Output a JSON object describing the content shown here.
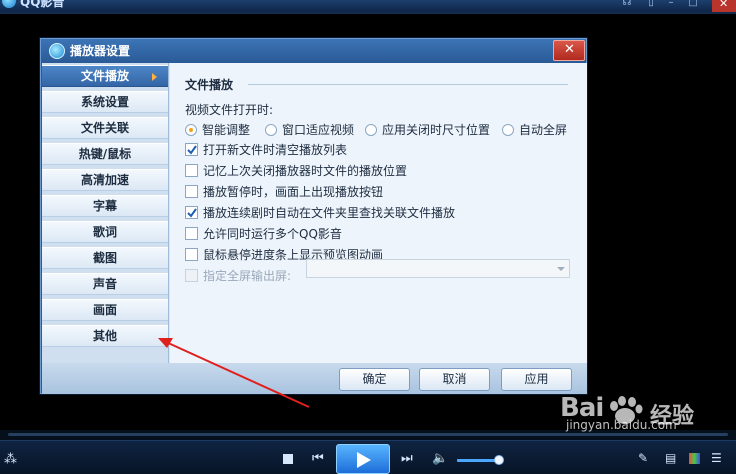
{
  "app": {
    "title": "QQ影音"
  },
  "dialog": {
    "title": "播放器设置",
    "close_symbol": "✕",
    "nav": [
      {
        "label": "文件播放",
        "active": true
      },
      {
        "label": "系统设置",
        "active": false
      },
      {
        "label": "文件关联",
        "active": false
      },
      {
        "label": "热键/鼠标",
        "active": false
      },
      {
        "label": "高清加速",
        "active": false
      },
      {
        "label": "字幕",
        "active": false
      },
      {
        "label": "歌词",
        "active": false
      },
      {
        "label": "截图",
        "active": false
      },
      {
        "label": "声音",
        "active": false
      },
      {
        "label": "画面",
        "active": false
      },
      {
        "label": "其他",
        "active": false
      }
    ],
    "section_title": "文件播放",
    "open_label": "视频文件打开时:",
    "radios": [
      {
        "label": "智能调整",
        "selected": true
      },
      {
        "label": "窗口适应视频",
        "selected": false
      },
      {
        "label": "应用关闭时尺寸位置",
        "selected": false
      },
      {
        "label": "自动全屏",
        "selected": false
      }
    ],
    "checkboxes": [
      {
        "label": "打开新文件时清空播放列表",
        "checked": true,
        "enabled": true
      },
      {
        "label": "记忆上次关闭播放器时文件的播放位置",
        "checked": false,
        "enabled": true
      },
      {
        "label": "播放暂停时，画面上出现播放按钮",
        "checked": false,
        "enabled": true
      },
      {
        "label": "播放连续剧时自动在文件夹里查找关联文件播放",
        "checked": true,
        "enabled": true
      },
      {
        "label": "允许同时运行多个QQ影音",
        "checked": false,
        "enabled": true
      },
      {
        "label": "鼠标悬停进度条上显示预览图动画",
        "checked": false,
        "enabled": true
      },
      {
        "label": "指定全屏输出屏:",
        "checked": false,
        "enabled": false
      }
    ],
    "screen_select": {
      "value": ""
    },
    "buttons": {
      "ok": "确定",
      "cancel": "取消",
      "apply": "应用"
    }
  },
  "player": {
    "volume_fraction": 0.9
  },
  "watermark": {
    "brand": "Bai",
    "brand_cn": "经验",
    "url": "jingyan.baidu.com"
  },
  "colors": {
    "annotation_arrow": "#e0201c",
    "accent": "#3466a6",
    "check_mark": "#1d5fb6",
    "radio_dot": "#f0a21a"
  }
}
